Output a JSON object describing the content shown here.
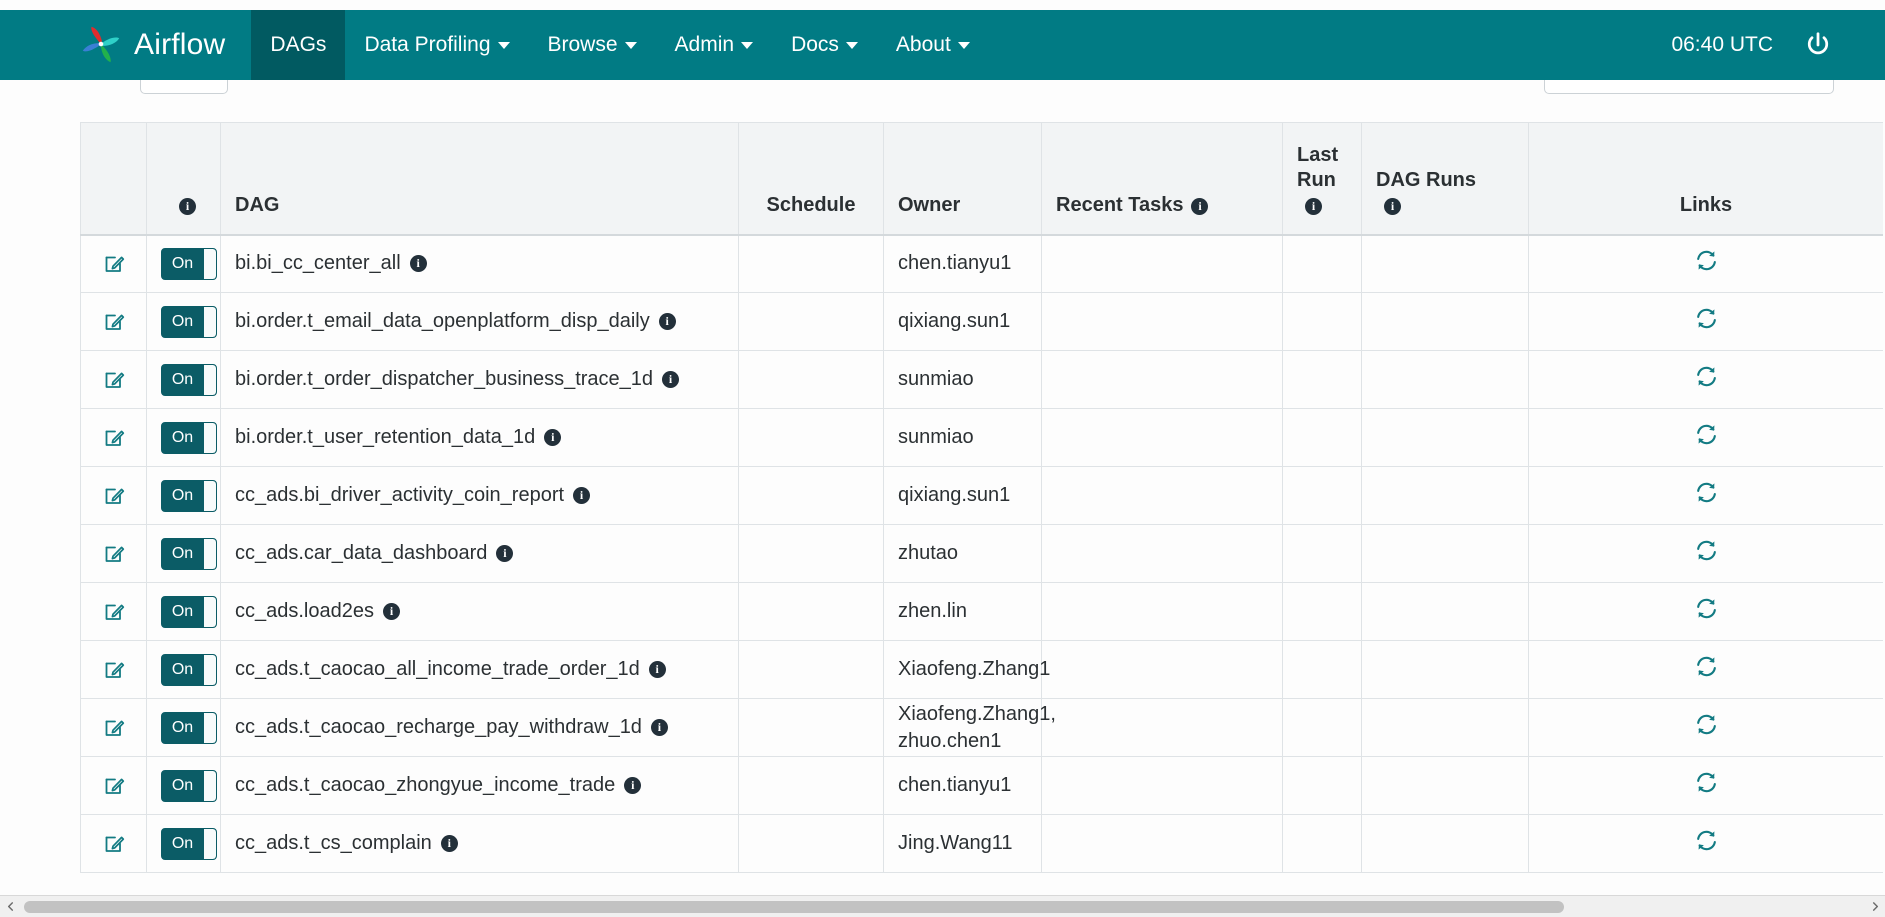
{
  "navbar": {
    "brand": "Airflow",
    "brand_logo_icon": "airflow-pinwheel-logo",
    "items": [
      {
        "label": "DAGs",
        "active": true,
        "caret": false
      },
      {
        "label": "Data Profiling",
        "active": false,
        "caret": true
      },
      {
        "label": "Browse",
        "active": false,
        "caret": true
      },
      {
        "label": "Admin",
        "active": false,
        "caret": true
      },
      {
        "label": "Docs",
        "active": false,
        "caret": true
      },
      {
        "label": "About",
        "active": false,
        "caret": true
      }
    ],
    "clock": "06:40 UTC",
    "power_icon": "power-icon"
  },
  "table": {
    "headers": {
      "edit": "",
      "toggle": "",
      "toggle_info": "i",
      "dag": "DAG",
      "schedule": "Schedule",
      "owner": "Owner",
      "recent_tasks": "Recent Tasks",
      "recent_tasks_info": "i",
      "last_run": "Last Run",
      "last_run_info": "i",
      "dag_runs": "DAG Runs",
      "dag_runs_info": "i",
      "links": "Links"
    },
    "rows": [
      {
        "toggle": "On",
        "dag": "bi.bi_cc_center_all",
        "schedule": "",
        "owner": "chen.tianyu1",
        "recent_tasks": "",
        "last_run": "",
        "dag_runs": "",
        "tall": false
      },
      {
        "toggle": "On",
        "dag": "bi.order.t_email_data_openplatform_disp_daily",
        "schedule": "",
        "owner": "qixiang.sun1",
        "recent_tasks": "",
        "last_run": "",
        "dag_runs": "",
        "tall": false
      },
      {
        "toggle": "On",
        "dag": "bi.order.t_order_dispatcher_business_trace_1d",
        "schedule": "",
        "owner": "sunmiao",
        "recent_tasks": "",
        "last_run": "",
        "dag_runs": "",
        "tall": false
      },
      {
        "toggle": "On",
        "dag": "bi.order.t_user_retention_data_1d",
        "schedule": "",
        "owner": "sunmiao",
        "recent_tasks": "",
        "last_run": "",
        "dag_runs": "",
        "tall": false
      },
      {
        "toggle": "On",
        "dag": "cc_ads.bi_driver_activity_coin_report",
        "schedule": "",
        "owner": "qixiang.sun1",
        "recent_tasks": "",
        "last_run": "",
        "dag_runs": "",
        "tall": false
      },
      {
        "toggle": "On",
        "dag": "cc_ads.car_data_dashboard",
        "schedule": "",
        "owner": "zhutao",
        "recent_tasks": "",
        "last_run": "",
        "dag_runs": "",
        "tall": false
      },
      {
        "toggle": "On",
        "dag": "cc_ads.load2es",
        "schedule": "",
        "owner": "zhen.lin",
        "recent_tasks": "",
        "last_run": "",
        "dag_runs": "",
        "tall": false
      },
      {
        "toggle": "On",
        "dag": "cc_ads.t_caocao_all_income_trade_order_1d",
        "schedule": "",
        "owner": "Xiaofeng.Zhang1",
        "recent_tasks": "",
        "last_run": "",
        "dag_runs": "",
        "tall": false
      },
      {
        "toggle": "On",
        "dag": "cc_ads.t_caocao_recharge_pay_withdraw_1d",
        "schedule": "",
        "owner": "Xiaofeng.Zhang1, zhuo.chen1",
        "recent_tasks": "",
        "last_run": "",
        "dag_runs": "",
        "tall": true
      },
      {
        "toggle": "On",
        "dag": "cc_ads.t_caocao_zhongyue_income_trade",
        "schedule": "",
        "owner": "chen.tianyu1",
        "recent_tasks": "",
        "last_run": "",
        "dag_runs": "",
        "tall": false
      },
      {
        "toggle": "On",
        "dag": "cc_ads.t_cs_complain",
        "schedule": "",
        "owner": "Jing.Wang11",
        "recent_tasks": "",
        "last_run": "",
        "dag_runs": "",
        "tall": false
      }
    ],
    "row_icons": {
      "edit": "edit-pencil-icon",
      "link_refresh": "refresh-icon",
      "info": "i"
    }
  },
  "colors": {
    "navbar_bg": "#017b84",
    "navbar_active_bg": "#015a61",
    "toggle_on_bg": "#0b5c66",
    "accent_teal": "#137b83"
  },
  "scrollbar": {
    "left_arrow_icon": "chevron-left-icon",
    "right_arrow_icon": "chevron-right-icon"
  }
}
